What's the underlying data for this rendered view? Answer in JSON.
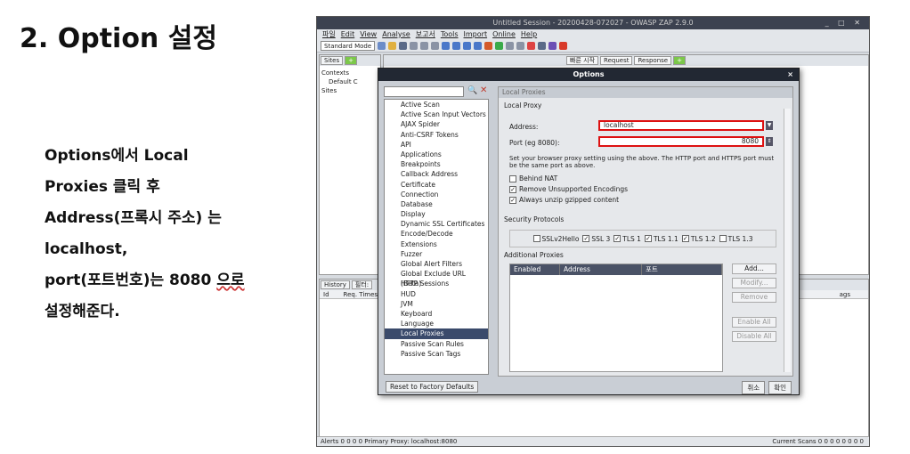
{
  "slide": {
    "title": "2. Option 설정",
    "desc": [
      "Options에서 Local",
      "Proxies 클릭 후",
      "Address(프록시 주소) 는",
      "localhost,",
      "port(포트번호)는 8080 ",
      "으로",
      "설정해준다."
    ]
  },
  "app": {
    "title": "Untitled Session - 20200428-072027 - OWASP ZAP 2.9.0",
    "menu": [
      "파일",
      "Edit",
      "View",
      "Analyse",
      "보고서",
      "Tools",
      "Import",
      "Online",
      "Help"
    ],
    "mode": "Standard Mode",
    "left_tab": "Sites",
    "tree": [
      "Contexts",
      "Default C",
      "Sites"
    ],
    "right_tabs": [
      "빠른 시작",
      "Request",
      "Response"
    ],
    "hist_tab": "History",
    "hist_filter": "필터:",
    "hist_cols": [
      "Id",
      "Req. Timest",
      "ags"
    ],
    "status_left": "Alerts  0  0  0  0   Primary Proxy: localhost:8080",
    "status_right": "Current Scans  0  0  0  0  0  0  0  0"
  },
  "dialog": {
    "title": "Options",
    "options": [
      "Active Scan",
      "Active Scan Input Vectors",
      "AJAX Spider",
      "Anti-CSRF Tokens",
      "API",
      "Applications",
      "Breakpoints",
      "Callback Address",
      "Certificate",
      "Connection",
      "Database",
      "Display",
      "Dynamic SSL Certificates",
      "Encode/Decode",
      "Extensions",
      "Fuzzer",
      "Global Alert Filters",
      "Global Exclude URL (Beta)",
      "HTTP Sessions",
      "HUD",
      "JVM",
      "Keyboard",
      "Language",
      "Local Proxies",
      "Passive Scan Rules",
      "Passive Scan Tags"
    ],
    "reset": "Reset to Factory Defaults",
    "cancel": "취소",
    "ok": "확인",
    "panel_header": "Local Proxies",
    "group_local": "Local Proxy",
    "address_label": "Address:",
    "address_value": "localhost",
    "port_label": "Port (eg 8080):",
    "port_value": "8080",
    "note": "Set your browser proxy setting using the above.  The HTTP port and HTTPS port must be the same port as above.",
    "behind_nat": "Behind NAT",
    "remove_enc": "Remove Unsupported Encodings",
    "unzip": "Always unzip gzipped content",
    "group_security": "Security Protocols",
    "protocols": [
      {
        "name": "SSLv2Hello",
        "checked": false
      },
      {
        "name": "SSL 3",
        "checked": true
      },
      {
        "name": "TLS 1",
        "checked": true
      },
      {
        "name": "TLS 1.1",
        "checked": true
      },
      {
        "name": "TLS 1.2",
        "checked": true
      },
      {
        "name": "TLS 1.3",
        "checked": false
      }
    ],
    "group_additional": "Additional Proxies",
    "table_cols": [
      "Enabled",
      "Address",
      "포트"
    ],
    "buttons": [
      "Add...",
      "Modify...",
      "Remove",
      "Enable All",
      "Disable All"
    ]
  }
}
